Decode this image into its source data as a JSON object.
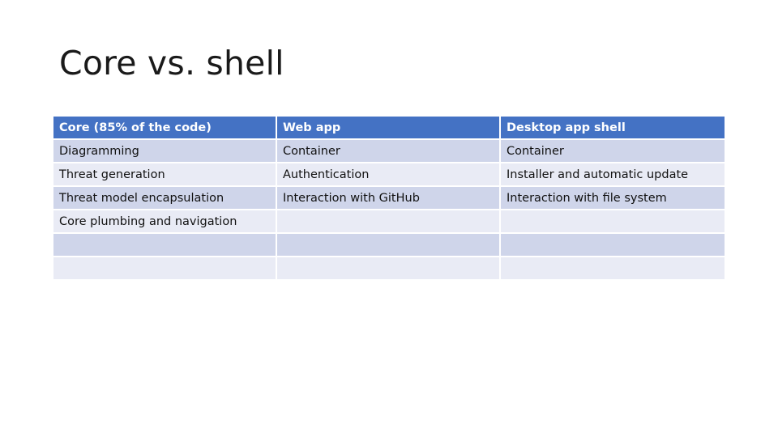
{
  "slide": {
    "title": "Core vs. shell"
  },
  "table": {
    "headers": [
      "Core (85% of the code)",
      "Web app",
      "Desktop app shell"
    ],
    "rows": [
      [
        "Diagramming",
        "Container",
        "Container"
      ],
      [
        "Threat generation",
        "Authentication",
        "Installer and automatic update"
      ],
      [
        "Threat model encapsulation",
        "Interaction with GitHub",
        "Interaction with file system"
      ],
      [
        "Core plumbing and navigation",
        "",
        ""
      ],
      [
        "",
        "",
        ""
      ],
      [
        "",
        "",
        ""
      ]
    ]
  },
  "colors": {
    "header": "#4472c4",
    "row_band_dark": "#cfd5ea",
    "row_band_light": "#e9ebf5"
  }
}
